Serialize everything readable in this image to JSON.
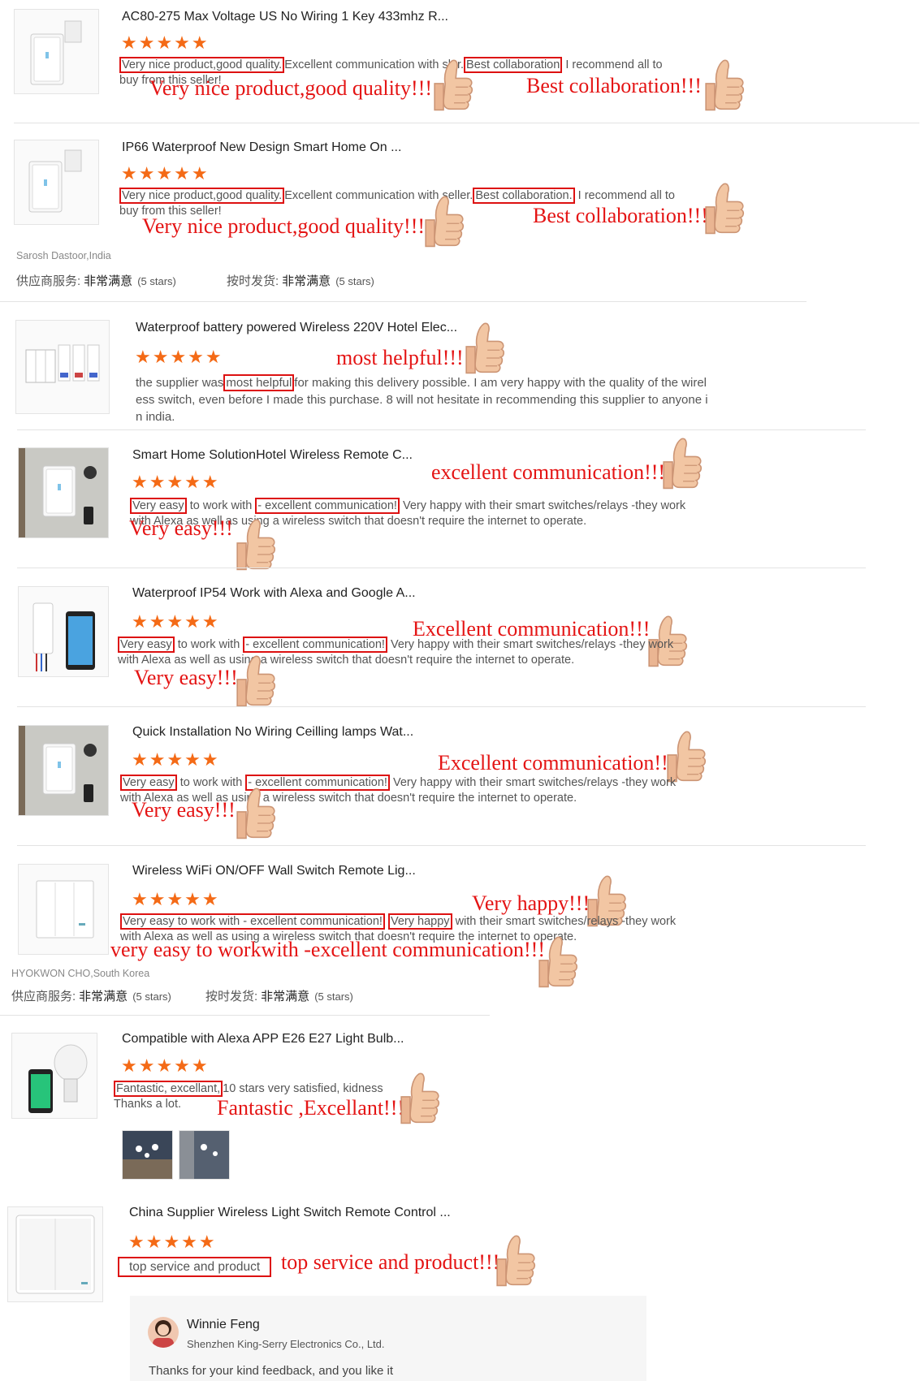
{
  "reviews": [
    {
      "title": "AC80-275 Max Voltage US No Wiring 1 Key 433mhz R...",
      "text_1": "Very nice product,good quality.",
      "text_2": "Excellent communication with s",
      "text_3": "ler.",
      "text_4": "Best collaboration",
      "text_5": "I recommend all to",
      "text_6": "buy from this seller!",
      "ann_1": "Very nice product,good quality!!!",
      "ann_2": "Best collaboration!!!"
    },
    {
      "title": "IP66 Waterproof New Design Smart Home On ...",
      "text_1": "Very nice product,good quality.",
      "text_2": "Excellent communication with",
      "text_3": "seller.",
      "text_4": "Best collaboration.",
      "text_5": "I recommend all to",
      "text_6": "buy from this seller!",
      "ann_1": "Very nice product,good quality!!!",
      "ann_2": "Best collaboration!!!",
      "reviewer": "Sarosh Dastoor,India",
      "rating_1_label": "供应商服务:",
      "rating_1_value": "非常满意",
      "rating_1_stars": "(5 stars)",
      "rating_2_label": "按时发货:",
      "rating_2_value": "非常满意",
      "rating_2_stars": "(5 stars)"
    },
    {
      "title": "Waterproof battery powered Wireless 220V Hotel Elec...",
      "text_1": "the supplier was",
      "text_2": "most helpful",
      "text_3": "for making this delivery possible. I am very happy with the quality of the wirel",
      "text_4": "ess switch, even before I made this purchase. 8 will not hesitate in recommending this supplier to anyone i",
      "text_5": "n india.",
      "ann_1": "most helpful!!!"
    },
    {
      "title": "Smart Home SolutionHotel Wireless Remote C...",
      "text_1": "Very easy",
      "text_2": "to work with",
      "text_3": "- excellent communication!",
      "text_4": "Very happy with their smart switches/relays -they work",
      "text_5": "with Alexa as well as using a wireless switch that doesn't require the internet to operate.",
      "ann_1": "excellent communication!!!",
      "ann_2": "Very easy!!!"
    },
    {
      "title": "Waterproof IP54 Work with Alexa and Google A...",
      "text_1": "Very easy",
      "text_2": "to work with",
      "text_3": "- excellent communication!",
      "text_4": "Very happy with their smart switches/relays -they work",
      "text_5": "with Alexa as well as using a wireless switch that doesn't require the internet to operate.",
      "ann_1": "Excellent communication!!!",
      "ann_2": "Very easy!!!"
    },
    {
      "title": "Quick Installation No Wiring Ceilling lamps Wat...",
      "text_1": "Very easy",
      "text_2": "to work with",
      "text_3": "- excellent communication!",
      "text_4": "Very happy with their smart switches/relays -they work",
      "text_5": "with Alexa as well as using a wireless switch that doesn't require the internet to operate.",
      "ann_1": "Excellent communication!!!",
      "ann_2": "Very easy!!!"
    },
    {
      "title": "Wireless WiFi ON/OFF Wall Switch Remote Lig...",
      "text_1": "Very easy to work with - excellent communication!",
      "text_2": "Very happy",
      "text_3": "with their smart switches/relays -they work",
      "text_4": "with Alexa as well as using a wireless switch that doesn't require the internet to operate.",
      "ann_1": "Very happy!!!",
      "ann_2": "very easy to workwith -excellent communication!!!",
      "reviewer": "HYOKWON CHO,South Korea",
      "rating_1_label": "供应商服务:",
      "rating_1_value": "非常满意",
      "rating_1_stars": "(5 stars)",
      "rating_2_label": "按时发货:",
      "rating_2_value": "非常满意",
      "rating_2_stars": "(5 stars)"
    },
    {
      "title": "Compatible with Alexa APP E26 E27 Light Bulb...",
      "text_1": "Fantastic, excellant,",
      "text_2": "10 stars very satisfied, kidness",
      "text_3": "Thanks a lot.",
      "ann_1": "Fantastic ,Excellant!!!"
    },
    {
      "title": "China Supplier Wireless Light Switch Remote Control ...",
      "text_1": "top service and product",
      "ann_1": "top service and product!!!"
    }
  ],
  "stars": "★★★★★",
  "reply": {
    "name": "Winnie Feng",
    "company": "Shenzhen King-Serry Electronics Co., Ltd.",
    "text": "Thanks for your kind feedback, and you like it"
  },
  "colors": {
    "star": "#f46a16",
    "highlight_box": "#dd1111",
    "annotation": "#e41414"
  },
  "icons": [
    "thumbs-up-icon",
    "star-icon",
    "avatar"
  ]
}
